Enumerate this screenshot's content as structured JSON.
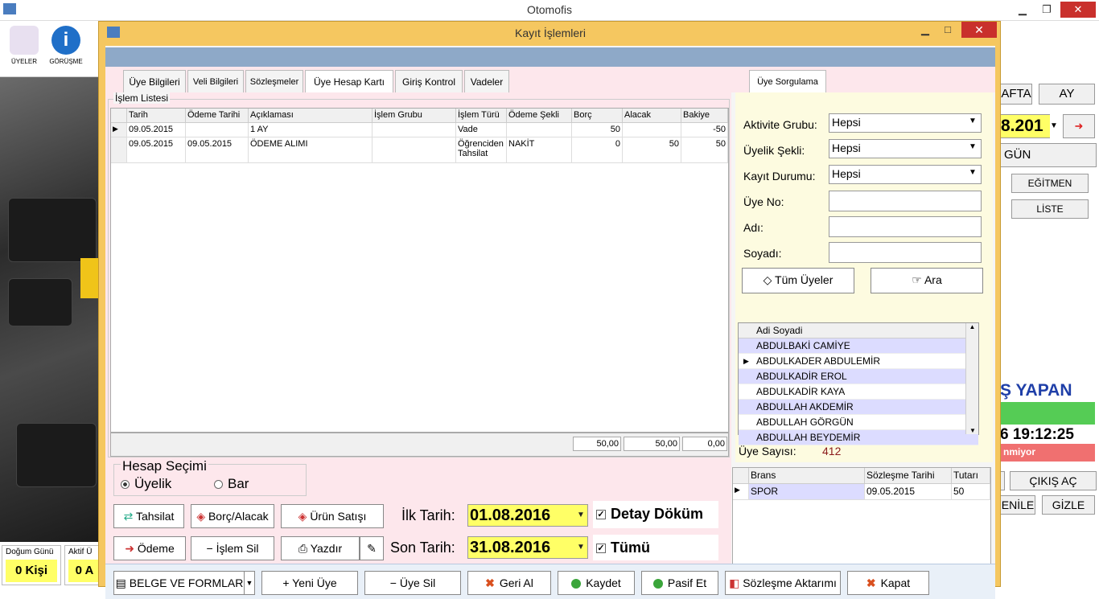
{
  "app": {
    "title": "Otomofis"
  },
  "toolbar": {
    "items": [
      {
        "label": "ÜYELER",
        "icon": "users-icon"
      },
      {
        "label": "GÖRÜŞME",
        "icon": "info-icon"
      }
    ]
  },
  "bottom_left": {
    "birthday_label": "Doğum Günü",
    "birthday_value": "0 Kişi",
    "active_label": "Aktif Ü",
    "active_value": "0 A"
  },
  "right_panel": {
    "hafta": "AFTA",
    "ay": "AY",
    "date_partial": "8.201",
    "gun": "GÜN",
    "egitmen": "EĞİTMEN",
    "liste": "LİSTE",
    "is_yapan": "Ş YAPAN",
    "time": "6 19:12:25",
    "status": "nmiyor",
    "cikis_ac": "ÇIKIŞ AÇ",
    "yenile": "ENİLE",
    "gizle": "GİZLE"
  },
  "dialog": {
    "title": "Kayıt İşlemleri"
  },
  "tabs": [
    "Üye Bilgileri",
    "Veli Bilgileri",
    "Sözleşmeler",
    "Üye Hesap Kartı",
    "Giriş Kontrol",
    "Vadeler"
  ],
  "query_tab": "Üye Sorgulama",
  "islem": {
    "title": "İşlem Listesi",
    "columns": [
      "Tarih",
      "Ödeme Tarihi",
      "Açıklaması",
      "İşlem Grubu",
      "İşlem Türü",
      "Ödeme Şekli",
      "Borç",
      "Alacak",
      "Bakiye"
    ],
    "rows": [
      {
        "tarih": "09.05.2015",
        "odeme_tarihi": "",
        "aciklama": "1 AY",
        "grup": "",
        "tur": "Vade",
        "sekil": "",
        "borc": "50",
        "alacak": "",
        "bakiye": "-50"
      },
      {
        "tarih": "09.05.2015",
        "odeme_tarihi": "09.05.2015",
        "aciklama": "ÖDEME ALIMI",
        "grup": "",
        "tur": "Öğrenciden Tahsilat",
        "sekil": "NAKİT",
        "borc": "0",
        "alacak": "50",
        "bakiye": "50"
      }
    ],
    "totals": {
      "borc": "50,00",
      "alacak": "50,00",
      "bakiye": "0,00"
    }
  },
  "hesap": {
    "title": "Hesap Seçimi",
    "opt1": "Üyelik",
    "opt2": "Bar",
    "selected": "Üyelik"
  },
  "actions": {
    "tahsilat": "Tahsilat",
    "borc_alacak": "Borç/Alacak",
    "urun_satisi": "Ürün Satışı",
    "odeme": "Ödeme",
    "islem_sil": "İşlem Sil",
    "yazdir": "Yazdır"
  },
  "dates": {
    "ilk_label": "İlk Tarih:",
    "ilk_value": "01.08.2016",
    "son_label": "Son Tarih:",
    "son_value": "31.08.2016",
    "detay": "Detay Döküm",
    "tumu": "Tümü"
  },
  "query": {
    "aktivite_label": "Aktivite Grubu:",
    "aktivite_value": "Hepsi",
    "uyelik_label": "Üyelik Şekli:",
    "uyelik_value": "Hepsi",
    "kayit_label": "Kayıt Durumu:",
    "kayit_value": "Hepsi",
    "uye_no_label": "Üye No:",
    "adi_label": "Adı:",
    "soyadi_label": "Soyadı:",
    "tum_uyeler": "Tüm Üyeler",
    "ara": "Ara",
    "list_header": "Adi Soyadi",
    "members": [
      "ABDULBAKİ CAMİYE",
      "ABDULKADER ABDULEMİR",
      "ABDULKADİR EROL",
      "ABDULKADİR KAYA",
      "ABDULLAH AKDEMİR",
      "ABDULLAH GÖRGÜN",
      "ABDULLAH BEYDEMİR"
    ],
    "count_label": "Üye Sayısı:",
    "count_value": "412"
  },
  "contract": {
    "columns": [
      "Brans",
      "Sözleşme Tarihi",
      "Tutarı"
    ],
    "rows": [
      {
        "brans": "SPOR",
        "tarih": "09.05.2015",
        "tutar": "50"
      }
    ]
  },
  "footer": {
    "belge": "BELGE VE FORMLAR",
    "yeni_uye": "Yeni Üye",
    "uye_sil": "Üye Sil",
    "geri_al": "Geri Al",
    "kaydet": "Kaydet",
    "pasif_et": "Pasif Et",
    "sozlesme": "Sözleşme Aktarımı",
    "kapat": "Kapat"
  },
  "colors": {
    "accent": "#f5c760",
    "highlight": "#ffff66",
    "pink": "#fde7ec",
    "list_alt": "#dcdcff"
  }
}
